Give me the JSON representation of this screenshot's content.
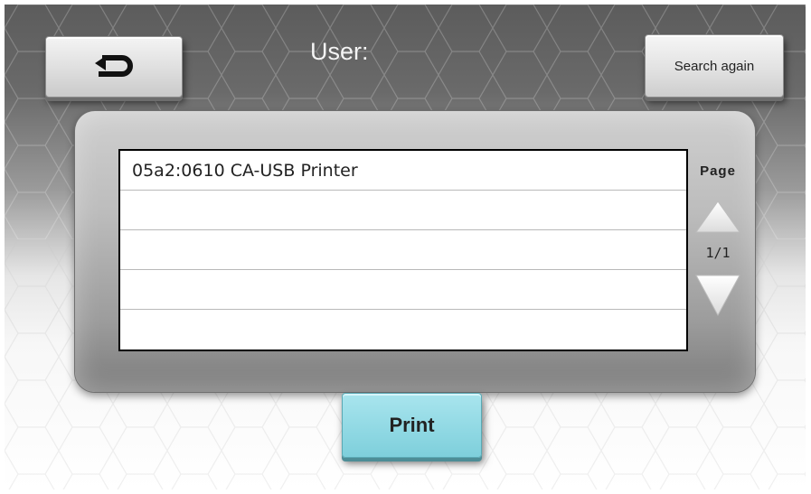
{
  "header": {
    "back_icon": "return-arrow-icon",
    "user_label": "User:",
    "search_again_label": "Search again"
  },
  "device_list": {
    "rows": [
      "05a2:0610 CA-USB Printer",
      "",
      "",
      "",
      ""
    ]
  },
  "pager": {
    "label": "Page",
    "indicator": "1/1",
    "up_icon": "triangle-up-icon",
    "down_icon": "triangle-down-icon"
  },
  "footer": {
    "print_label": "Print"
  },
  "colors": {
    "print_button": "#8fd8e3",
    "panel": "#b8b8b8"
  }
}
